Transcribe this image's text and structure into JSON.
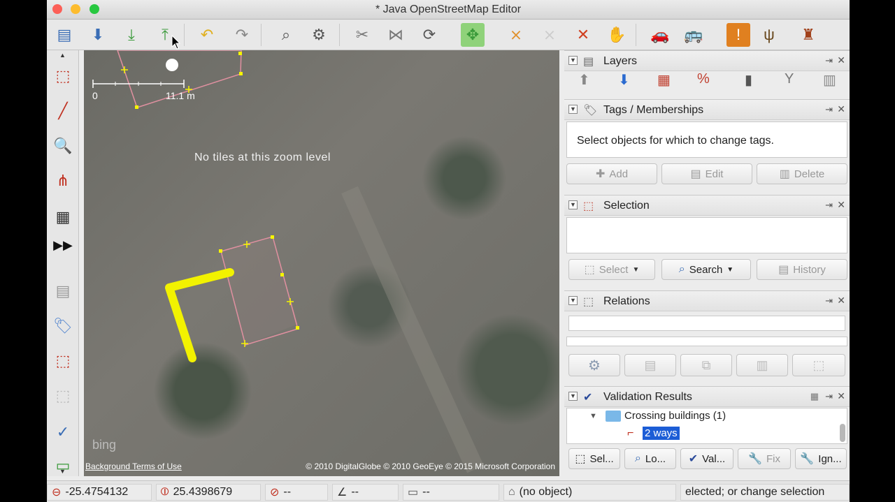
{
  "window": {
    "title": "* Java OpenStreetMap Editor"
  },
  "toolbar": {
    "icons": [
      "open-file-icon",
      "save-icon",
      "download-icon",
      "upload-icon",
      "undo-icon",
      "redo-icon",
      "zoom-preferences-icon",
      "preferences-icon",
      "split-way-icon",
      "combine-way-icon",
      "refresh-icon",
      "zoom-to-selection-icon",
      "draw-icon",
      "delete-icon",
      "split-icon",
      "pan-hand-icon",
      "car-preset-icon",
      "bus-preset-icon",
      "warning-preset-icon",
      "food-preset-icon",
      "castle-preset-icon"
    ]
  },
  "map": {
    "no_tiles_text": "No tiles at this zoom level",
    "scale_start": "0",
    "scale_end": "11.1 m",
    "bing_logo": "bing",
    "background_terms": "Background Terms of Use",
    "copyright": "© 2010 DigitalGlobe © 2010 GeoEye © 2015 Microsoft Corporation"
  },
  "panels": {
    "layers": {
      "title": "Layers"
    },
    "tags": {
      "title": "Tags / Memberships",
      "message": "Select objects for which to change tags.",
      "add": "Add",
      "edit": "Edit",
      "delete": "Delete"
    },
    "selection": {
      "title": "Selection",
      "select": "Select",
      "search": "Search",
      "history": "History"
    },
    "relations": {
      "title": "Relations"
    },
    "validation": {
      "title": "Validation Results",
      "group": "Crossing buildings (1)",
      "item": "2 ways",
      "select": "Sel...",
      "lookup": "Lo...",
      "validate": "Val...",
      "fix": "Fix",
      "ignore": "Ign..."
    }
  },
  "status": {
    "lat": "-25.4754132",
    "lon": "25.4398679",
    "heading": "--",
    "angle": "--",
    "length": "--",
    "object": "(no object)",
    "help": "elected; or change selection"
  }
}
